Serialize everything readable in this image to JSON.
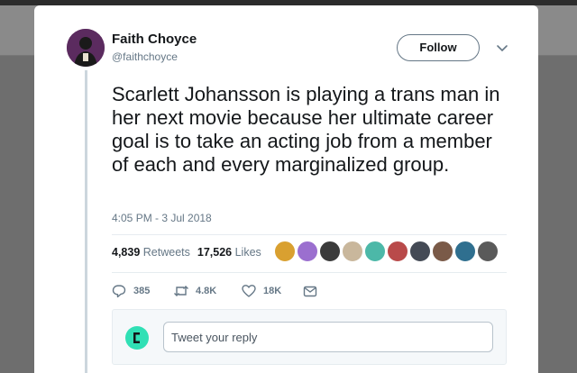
{
  "tweet": {
    "author_name": "Faith Choyce",
    "author_handle": "@faithchoyce",
    "follow_label": "Follow",
    "text": "Scarlett Johansson is playing a trans man in her next movie because her ultimate career goal is to take an acting job from a member of each and every marginalized group.",
    "timestamp": "4:05 PM - 3 Jul 2018"
  },
  "stats": {
    "retweets_count": "4,839",
    "retweets_label": "Retweets",
    "likes_count": "17,526",
    "likes_label": "Likes",
    "liker_avatar_count": 10
  },
  "actions": {
    "reply_count": "385",
    "retweet_count": "4.8K",
    "like_count": "18K"
  },
  "reply_box": {
    "placeholder": "Tweet your reply"
  },
  "colors": {
    "text_primary": "#14171a",
    "text_secondary": "#657786",
    "divider": "#e6ecf0",
    "reply_avatar": "#30e0b5"
  }
}
